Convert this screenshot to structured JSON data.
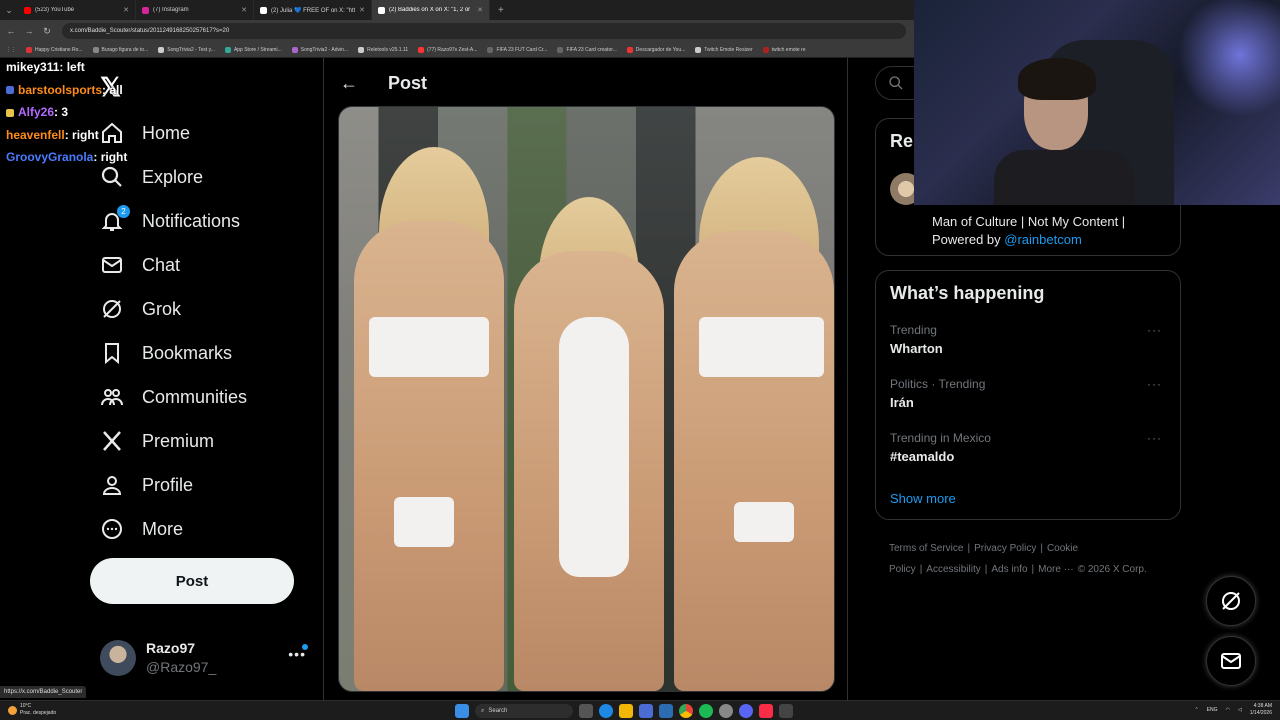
{
  "browser": {
    "tabs": [
      {
        "label": "(523) YouTube",
        "color": "#ff0000",
        "active": false
      },
      {
        "label": "(7) Instagram",
        "color": "#d6249f",
        "active": false
      },
      {
        "label": "(2) Julia 💙 FREE OF on X: \"htt",
        "color": "#ffffff",
        "active": false
      },
      {
        "label": "(2) Baddies on X on X: \"1, 2 or",
        "color": "#ffffff",
        "active": true
      }
    ],
    "new_tab": "+",
    "url": "x.com/Baddie_Scouter/status/2011249168250257617?s=20",
    "bookmarks": [
      {
        "label": "Happy Cristiano Ro...",
        "color": "#d33"
      },
      {
        "label": "Burago figura de to...",
        "color": "#888"
      },
      {
        "label": "SongTrivia2 - Test y...",
        "color": "#ccc"
      },
      {
        "label": "App Store / Streami...",
        "color": "#3a9"
      },
      {
        "label": "SongTrivia2 - Advin...",
        "color": "#a6c"
      },
      {
        "label": "Reletools v25.1.11",
        "color": "#ccc"
      },
      {
        "label": "(77) Razo97s Zest-A...",
        "color": "#f33"
      },
      {
        "label": "FIFA 23 FUT Card Cr...",
        "color": "#666"
      },
      {
        "label": "FIFA 23 Card creator...",
        "color": "#666"
      },
      {
        "label": "Descargador de You...",
        "color": "#e33"
      },
      {
        "label": "Twitch Emote Resizer",
        "color": "#ccc"
      },
      {
        "label": "twitch emote re",
        "color": "#a22"
      }
    ]
  },
  "chat": [
    {
      "user": "mikey311",
      "msg": ": left",
      "color": "#ffffff",
      "icon": ""
    },
    {
      "user": "barstoolsports",
      "msg": ": all",
      "color": "#ff8c1a",
      "icon": "#4a6cd4"
    },
    {
      "user": "Alfy26",
      "msg": ": 3",
      "color": "#b36bff",
      "icon": "#e8c34a"
    },
    {
      "user": "heavenfell",
      "msg": ": right",
      "color": "#ff8c1a",
      "icon": ""
    },
    {
      "user": "GroovyGranola",
      "msg": ": right",
      "color": "#4a7cff",
      "icon": ""
    }
  ],
  "nav": {
    "items": [
      {
        "label": "Home",
        "icon": "home-icon"
      },
      {
        "label": "Explore",
        "icon": "search-icon"
      },
      {
        "label": "Notifications",
        "icon": "bell-icon",
        "badge": "2"
      },
      {
        "label": "Chat",
        "icon": "mail-icon"
      },
      {
        "label": "Grok",
        "icon": "grok-icon"
      },
      {
        "label": "Bookmarks",
        "icon": "bookmark-icon"
      },
      {
        "label": "Communities",
        "icon": "communities-icon"
      },
      {
        "label": "Premium",
        "icon": "x-icon"
      },
      {
        "label": "Profile",
        "icon": "person-icon"
      },
      {
        "label": "More",
        "icon": "more-circle-icon"
      }
    ],
    "post_button": "Post",
    "account": {
      "name": "Razo97",
      "handle": "@Razo97_",
      "more": "•••"
    }
  },
  "main": {
    "title": "Post"
  },
  "right": {
    "search_placeholder": "S",
    "relevant_title": "Rel",
    "bio_text": "Man of Culture | Not My Content | Powered by ",
    "bio_link": "@rainbetcom",
    "happening_title": "What’s happening",
    "trends": [
      {
        "meta": "Trending",
        "name": "Wharton"
      },
      {
        "meta": "Politics · Trending",
        "name": "Irán"
      },
      {
        "meta": "Trending in Mexico",
        "name": "#teamaldo"
      }
    ],
    "trend_more": "···",
    "show_more": "Show more",
    "footer": [
      "Terms of Service",
      "|",
      "Privacy Policy",
      "|",
      "Cookie Policy",
      "|",
      "Accessibility",
      "|",
      "Ads info",
      "|",
      "More ···",
      "© 2026 X Corp."
    ]
  },
  "status_url": "https://x.com/Baddie_Scouter",
  "taskbar": {
    "temp": "10°C",
    "weather": "Prac. despejado",
    "search": "Search",
    "lang": "ENG",
    "time": "4:38 AM",
    "date": "1/14/2026"
  }
}
